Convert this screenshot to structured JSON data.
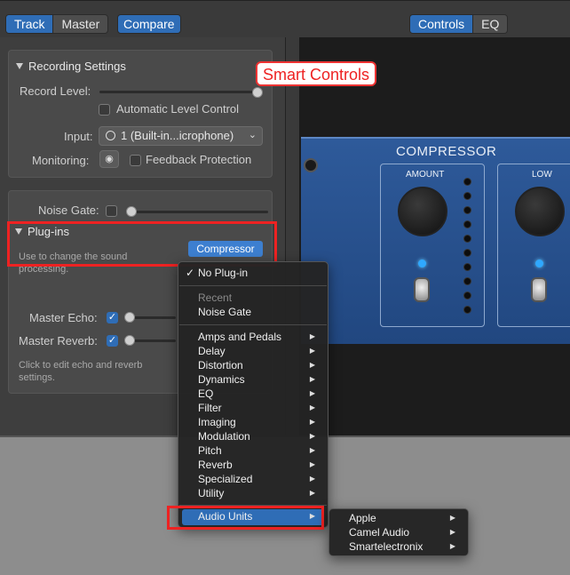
{
  "toolbar": {
    "track_label": "Track",
    "master_label": "Master",
    "compare_label": "Compare",
    "controls_label": "Controls",
    "eq_label": "EQ"
  },
  "overlay": {
    "smart_controls": "Smart Controls"
  },
  "recording": {
    "header": "Recording Settings",
    "record_level_label": "Record Level:",
    "record_level_value": 1.0,
    "auto_level_label": "Automatic Level Control",
    "auto_level_checked": false,
    "input_label": "Input:",
    "input_value": "1  (Built-in...icrophone)",
    "monitoring_label": "Monitoring:",
    "feedback_label": "Feedback Protection",
    "feedback_checked": false
  },
  "plugins_section": {
    "noise_gate_label": "Noise Gate:",
    "noise_gate_checked": false,
    "header": "Plug-ins",
    "hint": "Use to change the sound processing.",
    "compressor_button": "Compressor",
    "master_echo_label": "Master Echo:",
    "master_echo_checked": true,
    "master_reverb_label": "Master Reverb:",
    "master_reverb_checked": true,
    "echo_hint": "Click to edit echo and reverb settings."
  },
  "plugin_face": {
    "title": "COMPRESSOR",
    "amount_label": "AMOUNT",
    "low_label": "LOW"
  },
  "menu": {
    "no_plugin": "No Plug-in",
    "recent_header": "Recent",
    "noise_gate": "Noise Gate",
    "categories": [
      "Amps and Pedals",
      "Delay",
      "Distortion",
      "Dynamics",
      "EQ",
      "Filter",
      "Imaging",
      "Modulation",
      "Pitch",
      "Reverb",
      "Specialized",
      "Utility"
    ],
    "audio_units": "Audio Units"
  },
  "submenu": {
    "items": [
      "Apple",
      "Camel Audio",
      "Smartelectronix"
    ]
  },
  "colors": {
    "accent": "#2f6db6",
    "highlight": "#e22222"
  }
}
